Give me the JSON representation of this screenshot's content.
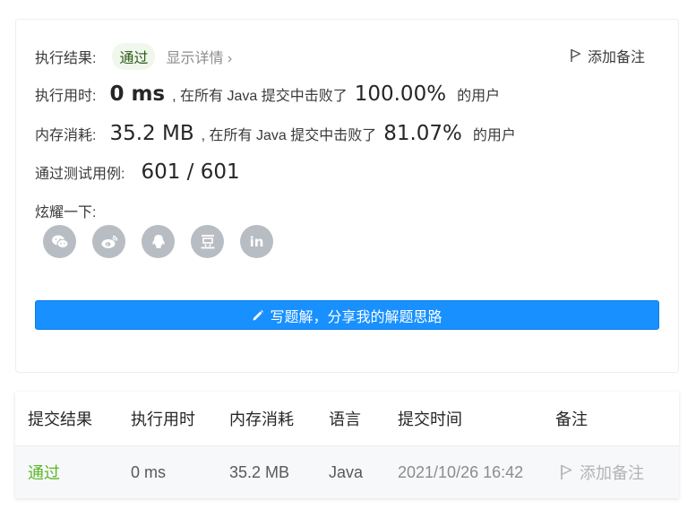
{
  "result": {
    "label": "执行结果:",
    "status": "通过",
    "details": "显示详情 ›",
    "add_note": "添加备注"
  },
  "runtime": {
    "label": "执行用时:",
    "value": "0 ms",
    "beat_text": ", 在所有 Java 提交中击败了",
    "percent": "100.00%",
    "suffix": "的用户"
  },
  "memory": {
    "label": "内存消耗:",
    "value": "35.2 MB",
    "beat_text": ", 在所有 Java 提交中击败了",
    "percent": "81.07%",
    "suffix": "的用户"
  },
  "tests": {
    "label": "通过测试用例:",
    "value": "601 / 601"
  },
  "share": {
    "label": "炫耀一下:",
    "icons": [
      "wechat-icon",
      "weibo-icon",
      "qq-icon",
      "douban-icon",
      "linkedin-icon"
    ]
  },
  "solution_button": "写题解，分享我的解题思路",
  "table": {
    "headers": [
      "提交结果",
      "执行用时",
      "内存消耗",
      "语言",
      "提交时间",
      "备注"
    ],
    "rows": [
      {
        "status": "通过",
        "runtime": "0 ms",
        "memory": "35.2 MB",
        "language": "Java",
        "time": "2021/10/26 16:42",
        "note": "添加备注"
      }
    ]
  },
  "colors": {
    "accent": "#1890ff",
    "pass": "#5ab726",
    "badge_bg": "#f0f7ec",
    "share_icon_bg": "#b8bdc4"
  }
}
